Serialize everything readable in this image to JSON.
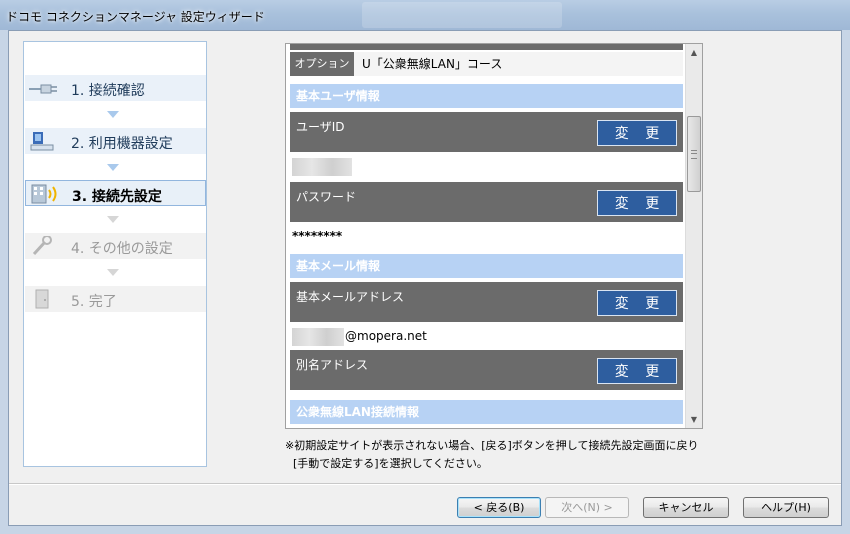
{
  "window": {
    "title": "ドコモ コネクションマネージャ 設定ウィザード"
  },
  "steps": [
    {
      "label": "1. 接続確認",
      "icon": "cable-plug-icon",
      "state": "done"
    },
    {
      "label": "2. 利用機器設定",
      "icon": "computer-device-icon",
      "state": "done"
    },
    {
      "label": "3. 接続先設定",
      "icon": "building-signal-icon",
      "state": "active"
    },
    {
      "label": "4. その他の設定",
      "icon": "wrench-icon",
      "state": "disabled"
    },
    {
      "label": "5. 完了",
      "icon": "door-icon",
      "state": "disabled"
    }
  ],
  "option": {
    "label": "オプション",
    "value": "U「公衆無線LAN」コース"
  },
  "sections": {
    "user": "基本ユーザ情報",
    "mail": "基本メール情報",
    "wlan": "公衆無線LAN接続情報"
  },
  "fields": {
    "user_id": {
      "label": "ユーザID",
      "button": "変 更"
    },
    "password": {
      "label": "パスワード",
      "button": "変 更",
      "value": "********"
    },
    "mail_address": {
      "label": "基本メールアドレス",
      "button": "変 更",
      "value": "@mopera.net"
    },
    "alias": {
      "label": "別名アドレス",
      "button": "変 更"
    }
  },
  "note": {
    "line1": "※初期設定サイトが表示されない場合、[戻る]ボタンを押して接続先設定画面に戻り",
    "line2": "[手動で設定する]を選択してください。"
  },
  "buttons": {
    "back": "< 戻る(B)",
    "next": "次へ(N) >",
    "cancel": "キャンセル",
    "help": "ヘルプ(H)"
  },
  "colors": {
    "section_header": "#b7d2f4",
    "field_bg": "#6b6b6b",
    "change_button": "#2e5e9f",
    "active_step_border": "#92b6de"
  }
}
